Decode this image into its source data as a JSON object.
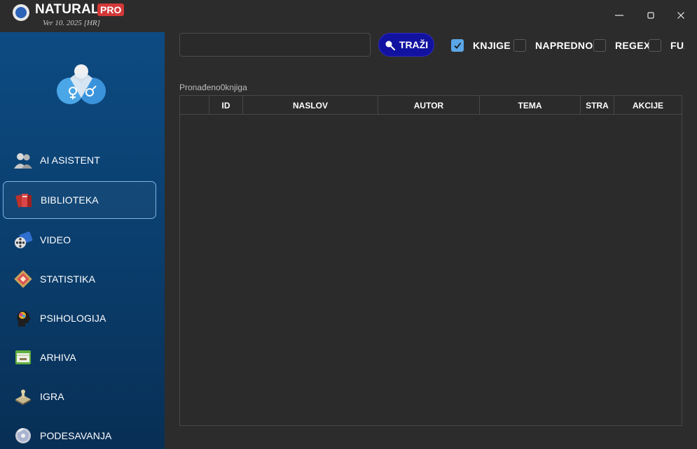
{
  "app": {
    "title": "NATURAL",
    "badge": "PRO",
    "version": "Ver 10. 2025 [HR]"
  },
  "window_controls": {
    "minimize": "—",
    "maximize": "▢",
    "close": "✕"
  },
  "sidebar": {
    "items": [
      {
        "label": "AI ASISTENT",
        "icon": "assistant-people-icon",
        "active": false
      },
      {
        "label": "BIBLIOTEKA",
        "icon": "books-icon",
        "active": true
      },
      {
        "label": "VIDEO",
        "icon": "video-film-icon",
        "active": false
      },
      {
        "label": "STATISTIKA",
        "icon": "statistics-chart-icon",
        "active": false
      },
      {
        "label": "PSIHOLOGIJA",
        "icon": "brain-head-icon",
        "active": false
      },
      {
        "label": "ARHIVA",
        "icon": "archive-box-icon",
        "active": false
      },
      {
        "label": "IGRA",
        "icon": "game-chess-icon",
        "active": false
      },
      {
        "label": "PODESAVANJA",
        "icon": "settings-disc-icon",
        "active": false
      }
    ]
  },
  "search": {
    "value": "",
    "button_label": "TRAŽI"
  },
  "options": [
    {
      "label": "KNJIGE",
      "checked": true
    },
    {
      "label": "NAPREDNO",
      "checked": false
    },
    {
      "label": "REGEX",
      "checked": false
    },
    {
      "label": "FUZ",
      "checked": false
    }
  ],
  "results": {
    "count_text": "Pronađeno0knjiga"
  },
  "table": {
    "columns": [
      "",
      "ID",
      "NASLOV",
      "AUTOR",
      "TEMA",
      "STRA",
      "AKCIJE"
    ],
    "rows": []
  },
  "colors": {
    "accent": "#1212a0",
    "checkbox_on": "#5aa7e8",
    "pro_badge": "#d33838",
    "sidebar_top": "#0d4b82",
    "sidebar_bottom": "#082f55"
  }
}
